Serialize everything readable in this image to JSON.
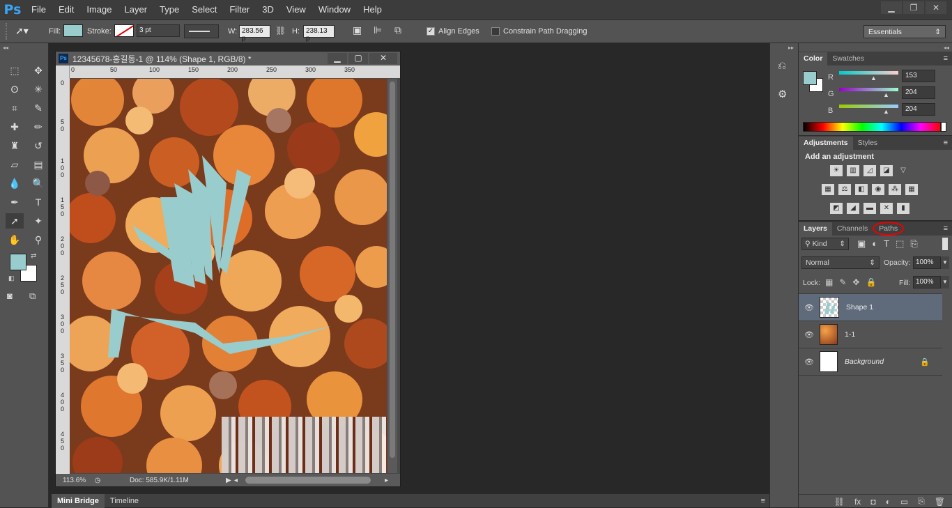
{
  "app": {
    "logo": "Ps"
  },
  "menu": [
    "File",
    "Edit",
    "Image",
    "Layer",
    "Type",
    "Select",
    "Filter",
    "3D",
    "View",
    "Window",
    "Help"
  ],
  "options": {
    "fill_label": "Fill:",
    "stroke_label": "Stroke:",
    "stroke_width": "3 pt",
    "w_label": "W:",
    "w_value": "283.56 p",
    "h_label": "H:",
    "h_value": "238.13 p",
    "align_edges": "Align Edges",
    "constrain": "Constrain Path Dragging",
    "workspace": "Essentials",
    "fill_color": "#99cccc"
  },
  "document": {
    "title": "12345678-홍길동-1 @ 114% (Shape 1, RGB/8) *",
    "zoom": "113.6%",
    "doc_info": "Doc: 585.9K/1.11M",
    "ruler_top": [
      "0",
      "50",
      "100",
      "150",
      "200",
      "250",
      "300",
      "350"
    ],
    "ruler_left": [
      "0",
      "5 0",
      "1 0 0",
      "1 5 0",
      "2 0 0",
      "2 5 0",
      "3 0 0",
      "3 5 0",
      "4 0 0",
      "4 5 0"
    ]
  },
  "bottom_tabs": [
    "Mini Bridge",
    "Timeline"
  ],
  "color_panel": {
    "tabs": [
      "Color",
      "Swatches"
    ],
    "r_label": "R",
    "g_label": "G",
    "b_label": "B",
    "r": "153",
    "g": "204",
    "b": "204"
  },
  "adjustments_panel": {
    "tabs": [
      "Adjustments",
      "Styles"
    ],
    "heading": "Add an adjustment"
  },
  "layers_panel": {
    "tabs": [
      "Layers",
      "Channels",
      "Paths"
    ],
    "kind": "Kind",
    "blend_mode": "Normal",
    "opacity_label": "Opacity:",
    "opacity": "100%",
    "lock_label": "Lock:",
    "fill_label": "Fill:",
    "fill": "100%",
    "layers": [
      {
        "name": "Shape 1"
      },
      {
        "name": "1-1"
      },
      {
        "name": "Background"
      }
    ]
  }
}
